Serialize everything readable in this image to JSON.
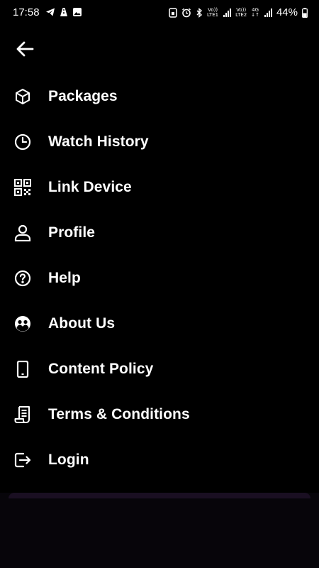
{
  "status_bar": {
    "time": "17:58",
    "battery": "44%",
    "lte1": "LTE1",
    "lte2": "LTE2",
    "net": "4G"
  },
  "back_icon": "arrow-left-icon",
  "menu": {
    "items": [
      {
        "label": "Packages",
        "icon": "box-icon"
      },
      {
        "label": "Watch History",
        "icon": "clock-icon"
      },
      {
        "label": "Link Device",
        "icon": "qr-code-icon"
      },
      {
        "label": "Profile",
        "icon": "user-icon"
      },
      {
        "label": "Help",
        "icon": "help-circle-icon"
      },
      {
        "label": "About Us",
        "icon": "group-icon"
      },
      {
        "label": "Content Policy",
        "icon": "phone-icon"
      },
      {
        "label": "Terms & Conditions",
        "icon": "scroll-icon"
      },
      {
        "label": "Login",
        "icon": "login-icon"
      }
    ]
  },
  "colors": {
    "background": "#000000",
    "text": "#ffffff",
    "bottom_panel": "#07050a",
    "card_accent": "#1a0f22"
  }
}
